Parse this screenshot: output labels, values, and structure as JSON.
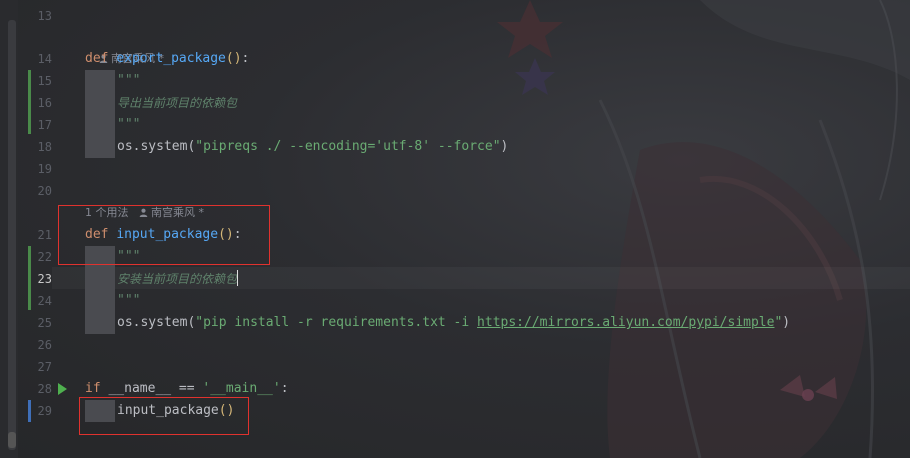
{
  "editor": {
    "line_numbers": [
      "13",
      "14",
      "15",
      "16",
      "17",
      "18",
      "19",
      "20",
      "21",
      "22",
      "23",
      "24",
      "25",
      "26",
      "27",
      "28",
      "29"
    ],
    "current_line": "23",
    "hints": {
      "author_1": "南宫乘风 *",
      "usages": "1 个用法",
      "author_2": "南宫乘风 *"
    },
    "lines": {
      "l14_def": "def",
      "l14_name": "export_package",
      "l14_paren": "()",
      "l14_colon": ":",
      "l15": "\"\"\"",
      "l16": "导出当前项目的依赖包",
      "l17": "\"\"\"",
      "l18_call": "os.system(",
      "l18_str": "\"pipreqs ./ --encoding='utf-8' --force\"",
      "l18_close": ")",
      "l21_def": "def",
      "l21_name": "input_package",
      "l21_paren": "()",
      "l21_colon": ":",
      "l22": "\"\"\"",
      "l23": "安装当前项目的依赖包",
      "l24": "\"\"\"",
      "l25_call": "os.system(",
      "l25_str_a": "\"pip install -r requirements.txt -i ",
      "l25_link": "https://mirrors.aliyun.com/pypi/simple",
      "l25_str_b": "\"",
      "l25_close": ")",
      "l28_if": "if",
      "l28_mid": " __name__ == ",
      "l28_str": "'__main__'",
      "l28_colon": ":",
      "l29_call": "input_package",
      "l29_paren": "()"
    }
  },
  "colors": {
    "keyword": "#cf8e6d",
    "function": "#56a8f5",
    "string": "#6aab73",
    "docstring": "#5f826b",
    "annotation_box": "#e0322e"
  },
  "icons": [
    "person-icon",
    "run-icon"
  ]
}
